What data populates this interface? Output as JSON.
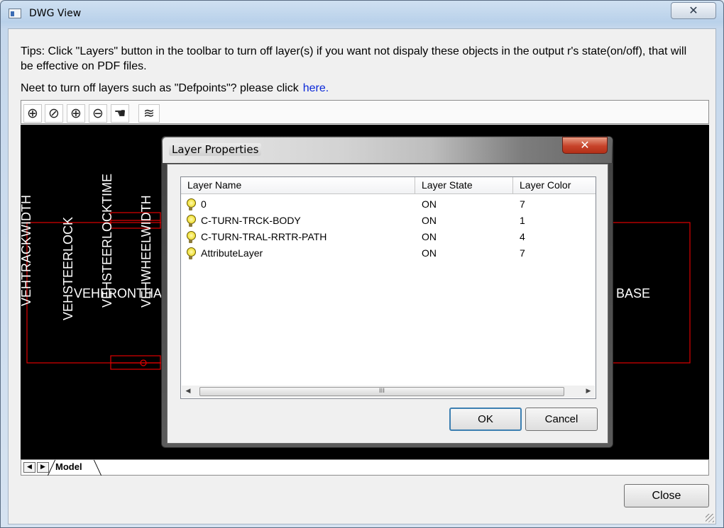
{
  "window": {
    "title": "DWG View",
    "close_glyph": "✕"
  },
  "tips": "Tips: Click \"Layers\" button in the toolbar to turn off layer(s) if you want not dispaly these objects in the output r's state(on/off), that will be effective on PDF files.",
  "need": {
    "text": "Neet to turn off layers such as \"Defpoints\"? please click",
    "link": "here."
  },
  "toolbar": {
    "buttons": [
      {
        "name": "zoom-extents-icon",
        "glyph": "⊕"
      },
      {
        "name": "zoom-window-icon",
        "glyph": "⊘"
      },
      {
        "name": "zoom-in-icon",
        "glyph": "⊕"
      },
      {
        "name": "zoom-out-icon",
        "glyph": "⊖"
      },
      {
        "name": "pan-hand-icon",
        "glyph": "☚"
      },
      {
        "name": "layers-icon",
        "glyph": "≋"
      }
    ]
  },
  "drawing": {
    "colors": {
      "background": "#000000",
      "lines": "#e00000",
      "text": "#ffffff"
    },
    "texts": [
      "VEHSTEERLOCK",
      "VEHSTEERLOCKTIME",
      "VEHWHEELWIDTH",
      "VEHFRONTHA",
      "VEHTRACKWIDTH",
      "BASE"
    ]
  },
  "tabs": {
    "prev_glyph": "◀",
    "next_glyph": "▶",
    "model": "Model"
  },
  "close_button": "Close",
  "layer_dialog": {
    "title": "Layer Properties",
    "close_glyph": "✕",
    "columns": [
      "Layer Name",
      "Layer State",
      "Layer Color"
    ],
    "rows": [
      {
        "name": "0",
        "state": "ON",
        "color": "7"
      },
      {
        "name": "C-TURN-TRCK-BODY",
        "state": "ON",
        "color": "1"
      },
      {
        "name": "C-TURN-TRAL-RRTR-PATH",
        "state": "ON",
        "color": "4"
      },
      {
        "name": "AttributeLayer",
        "state": "ON",
        "color": "7"
      }
    ],
    "scroll": {
      "left": "◀",
      "right": "▶",
      "thumb": "III"
    },
    "ok": "OK",
    "cancel": "Cancel"
  }
}
